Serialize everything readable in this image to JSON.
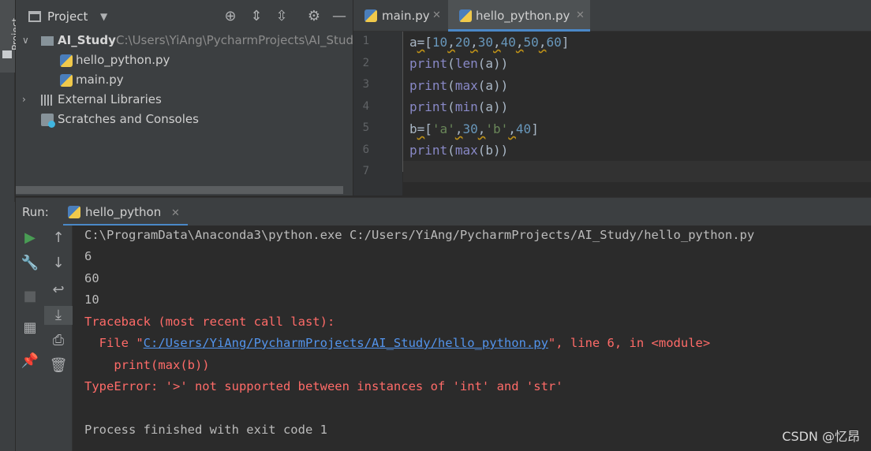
{
  "tool_stripe": {
    "project_label": "Project"
  },
  "project_panel": {
    "title": "Project",
    "tree": {
      "root_name": "AI_Study",
      "root_path": "C:\\Users\\YiAng\\PycharmProjects\\AI_Study",
      "files": [
        "hello_python.py",
        "main.py"
      ],
      "external_libraries": "External Libraries",
      "scratches": "Scratches and Consoles"
    }
  },
  "editor": {
    "tabs": [
      {
        "label": "main.py",
        "active": false
      },
      {
        "label": "hello_python.py",
        "active": true
      }
    ],
    "line_numbers": [
      "1",
      "2",
      "3",
      "4",
      "5",
      "6",
      "7"
    ],
    "code": [
      "a=[10,20,30,40,50,60]",
      "print(len(a))",
      "print(max(a))",
      "print(min(a))",
      "b=['a',30,'b',40]",
      "print(max(b))",
      ""
    ]
  },
  "run_panel": {
    "label": "Run:",
    "tab_label": "hello_python",
    "output": {
      "command": "C:\\ProgramData\\Anaconda3\\python.exe C:/Users/YiAng/PycharmProjects/AI_Study/hello_python.py",
      "stdout": [
        "6",
        "60",
        "10"
      ],
      "traceback_header": "Traceback (most recent call last):",
      "file_prefix": "  File \"",
      "file_link": "C:/Users/YiAng/PycharmProjects/AI_Study/hello_python.py",
      "file_suffix": "\", line 6, in <module>",
      "error_code_line": "    print(max(b))",
      "error_message": "TypeError: '>' not supported between instances of 'int' and 'str'",
      "exit_message": "Process finished with exit code 1"
    }
  },
  "watermark": "CSDN @忆昂",
  "colors": {
    "accent": "#4a88c7",
    "error": "#ff6b68",
    "link": "#5394ec",
    "run_green": "#499c54"
  }
}
